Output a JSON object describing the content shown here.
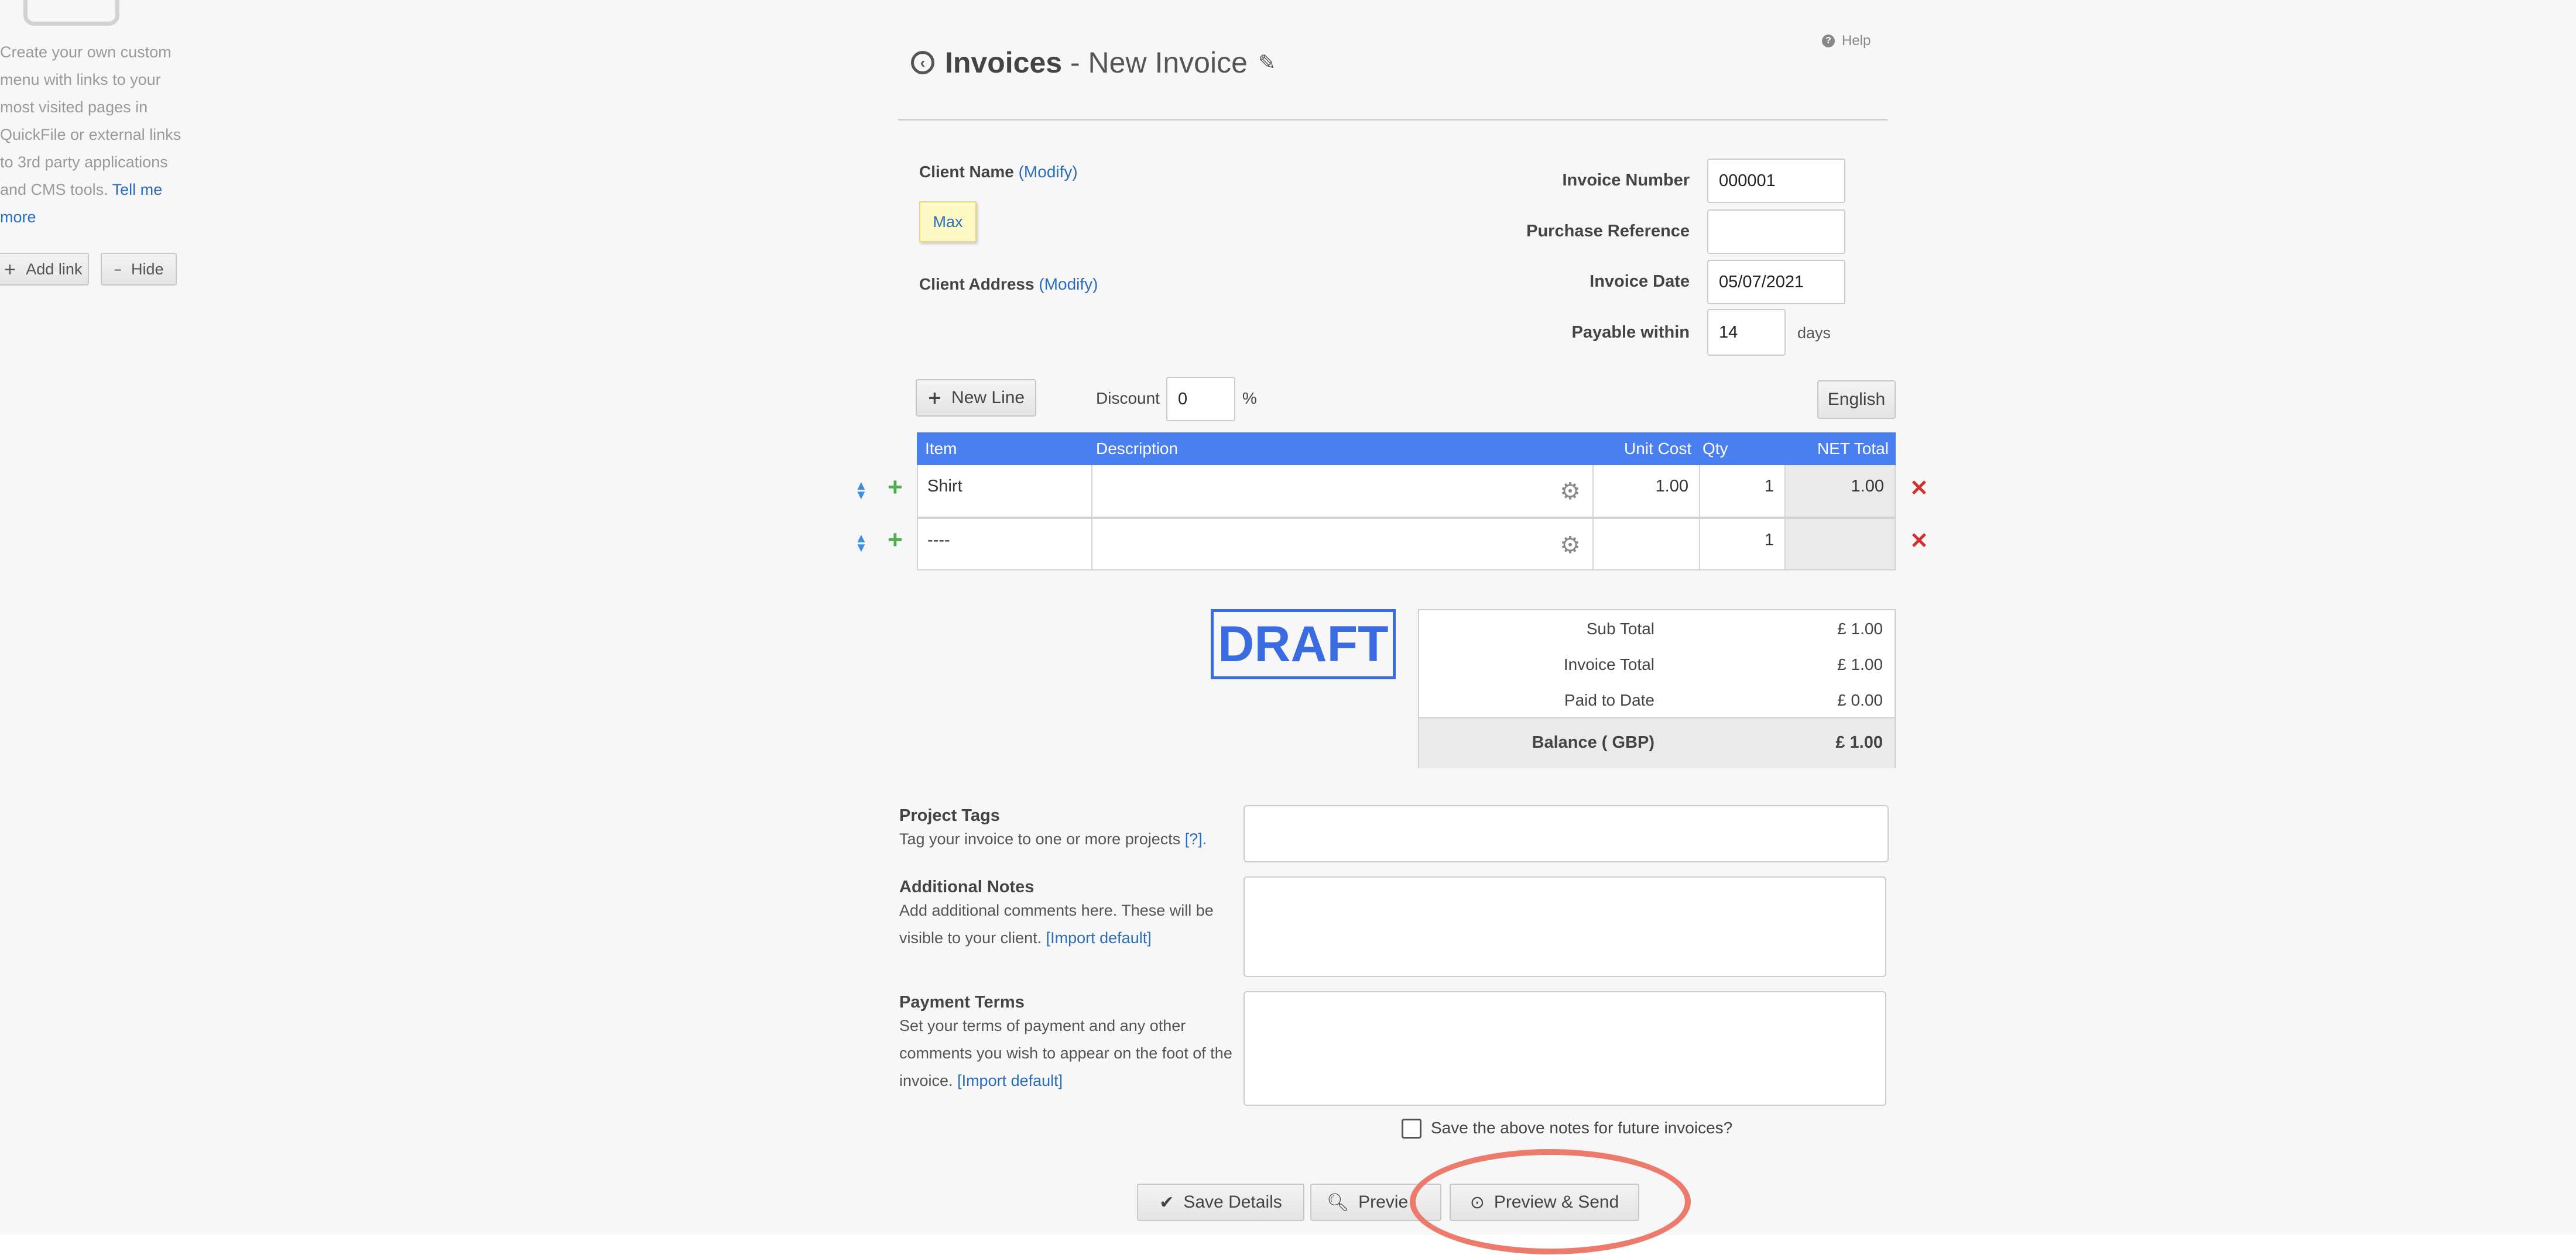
{
  "sidebar": {
    "description": "Create your own custom menu with links to your most visited pages in QuickFile or external links to 3rd party applications and CMS tools.",
    "tell_more": "Tell me more",
    "add_link": "Add link",
    "hide": "Hide"
  },
  "header": {
    "title": "Invoices",
    "separator": " - ",
    "subtitle": "New Invoice",
    "help": "Help"
  },
  "client": {
    "name_label": "Client Name",
    "modify": "(Modify)",
    "name_value": "Max",
    "address_label": "Client Address",
    "address_modify": "(Modify)"
  },
  "invoice_meta": {
    "number_label": "Invoice Number",
    "number_value": "000001",
    "purchase_ref_label": "Purchase Reference",
    "purchase_ref_value": "",
    "date_label": "Invoice Date",
    "date_value": "05/07/2021",
    "payable_label": "Payable within",
    "payable_value": "14",
    "payable_unit": "days"
  },
  "toolbar": {
    "new_line": "New Line",
    "discount_label": "Discount",
    "discount_value": "0",
    "discount_unit": "%",
    "language": "English"
  },
  "table": {
    "headers": [
      "Item",
      "Description",
      "Unit Cost",
      "Qty",
      "NET Total"
    ],
    "rows": [
      {
        "item": "Shirt",
        "description": "",
        "unit_cost": "1.00",
        "qty": "1",
        "net_total": "1.00"
      },
      {
        "item": "----",
        "description": "",
        "unit_cost": "",
        "qty": "1",
        "net_total": ""
      }
    ]
  },
  "status_stamp": "DRAFT",
  "totals": {
    "sub_total_label": "Sub Total",
    "sub_total": "£ 1.00",
    "invoice_total_label": "Invoice Total",
    "invoice_total": "£ 1.00",
    "paid_label": "Paid to Date",
    "paid": "£ 0.00",
    "balance_label": "Balance ( GBP)",
    "balance": "£ 1.00"
  },
  "project_tags": {
    "title": "Project Tags",
    "desc": "Tag your invoice to one or more projects",
    "help_link": "[?]."
  },
  "notes": {
    "title": "Additional Notes",
    "desc": "Add additional comments here. These will be visible to your client.",
    "import": "[Import default]"
  },
  "terms": {
    "title": "Payment Terms",
    "desc": "Set your terms of payment and any other comments you wish to appear on the foot of the invoice.",
    "import": "[Import default]"
  },
  "save_notes_label": "Save the above notes for future invoices?",
  "actions": {
    "save": "Save Details",
    "preview": "Previe",
    "preview_send": "Preview & Send"
  },
  "colors": {
    "table_header": "#4a7ff0",
    "draft": "#3b6be0",
    "highlight": "#ec7b6b"
  }
}
